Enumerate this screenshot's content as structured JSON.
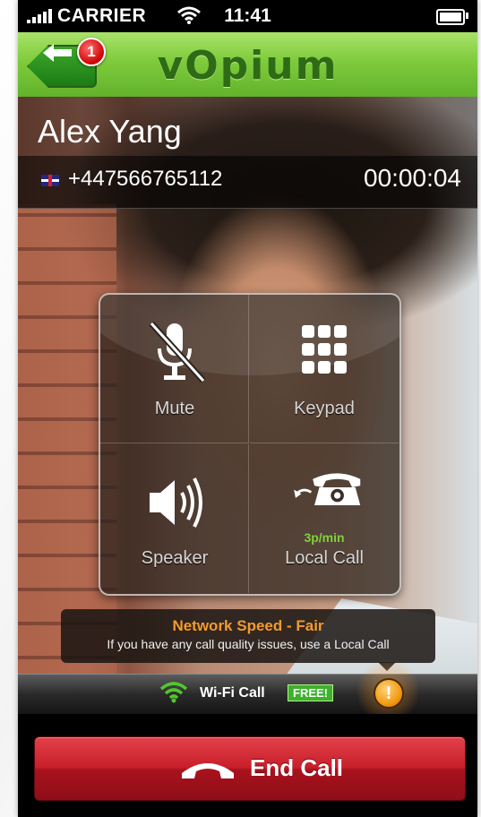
{
  "status_bar": {
    "carrier": "CARRIER",
    "time": "11:41"
  },
  "header": {
    "logo": "vOpium",
    "notification_count": "1"
  },
  "call": {
    "caller_name": "Alex Yang",
    "phone_number": "+447566765112",
    "duration": "00:00:04",
    "country_flag": "uk-flag-icon"
  },
  "controls": {
    "mute_label": "Mute",
    "keypad_label": "Keypad",
    "speaker_label": "Speaker",
    "local_call_label": "Local Call",
    "local_call_rate": "3p/min"
  },
  "network": {
    "title": "Network Speed - Fair",
    "message": "If you have any call quality issues, use a Local Call"
  },
  "connection": {
    "label": "Wi-Fi Call",
    "badge": "FREE!",
    "alert_symbol": "!"
  },
  "end_call": {
    "label": "End Call"
  },
  "colors": {
    "header_green": "#7ecb3c",
    "end_call_red": "#c81f2a",
    "network_title_orange": "#f39a2e",
    "free_badge_green": "#3db12d",
    "rate_green": "#7fd23a"
  }
}
